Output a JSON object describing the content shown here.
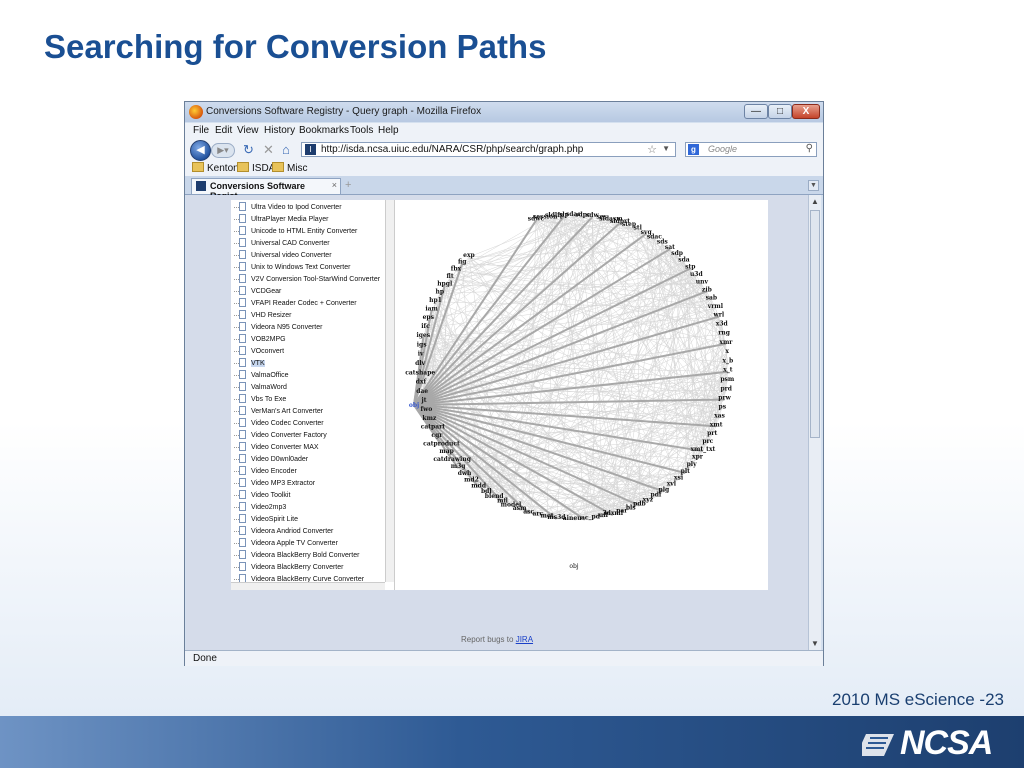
{
  "slide": {
    "title": "Searching for Conversion Paths",
    "footer": "2010 MS eScience -23",
    "logo": "NCSA",
    "colors": {
      "title": "#1a4f93",
      "footer_bar": "#2e5a94"
    }
  },
  "browser": {
    "window_title": "Conversions Software Registry - Query graph - Mozilla Firefox",
    "window_buttons": {
      "minimize": "—",
      "maximize": "□",
      "close": "X"
    },
    "menu": [
      "File",
      "Edit",
      "View",
      "History",
      "Bookmarks",
      "Tools",
      "Help"
    ],
    "url": "http://isda.ncsa.uiuc.edu/NARA/CSR/php/search/graph.php",
    "search_placeholder": "Google",
    "bookmarks": [
      "Kenton",
      "ISDA",
      "Misc"
    ],
    "tab_label": "Conversions Software Regist...",
    "status": "Done",
    "report_text": "Report bugs to",
    "report_link": "JIRA"
  },
  "software_list": [
    "Ultra Video to Ipod Converter",
    "UltraPlayer Media Player",
    "Unicode to HTML Entity Converter",
    "Universal CAD Converter",
    "Universal video Converter",
    "Unix to Windows Text Converter",
    "V2V Conversion Tool-StarWind Converter",
    "VCDGear",
    "VFAPI Reader Codec + Converter",
    "VHD Resizer",
    "Videora N95 Converter",
    "VOB2MPG",
    "VOconvert",
    "VTK",
    "ValmaOffice",
    "ValmaWord",
    "Vbs To Exe",
    "VerMan's Art Converter",
    "Video Codec Converter",
    "Video Converter Factory",
    "Video Converter MAX",
    "Video D0wnl0ader",
    "Video Encoder",
    "Video MP3 Extractor",
    "Video Toolkit",
    "Video2mp3",
    "VideoSpirit Lite",
    "Videora Andriod Converter",
    "Videora Apple TV Converter",
    "Videora BlackBerry Bold Converter",
    "Videora BlackBerry Converter",
    "Videora BlackBerry Curve Converter"
  ],
  "selected_item": "VTK",
  "graph": {
    "source_label": "obj",
    "bottom_label": "obj",
    "nodes": [
      "sdwc",
      "session",
      "sldlfp",
      "slp",
      "sdac",
      "sdpc",
      "sdw",
      "ses",
      "sldasm",
      "sldprt",
      "step",
      "stl",
      "svg",
      "sdac",
      "sds",
      "sat",
      "sdp",
      "sda",
      "stp",
      "u3d",
      "unv",
      "zib",
      "sab",
      "vrml",
      "wrl",
      "x3d",
      "rng",
      "xmr",
      "x",
      "x_b",
      "x_t",
      "psm",
      "prd",
      "prw",
      "ps",
      "xas",
      "xmt",
      "prt",
      "prc",
      "xmt_txt",
      "xpr",
      "ply",
      "plt",
      "xsi",
      "xvl",
      "plg",
      "pdf",
      "xyz",
      "pdb",
      "bls",
      "par",
      "3dxml",
      "uff",
      "_pd",
      "ac",
      "neu",
      "ai",
      "ms3d",
      "mot",
      "arc",
      "asc",
      "asm",
      "model",
      "mfl",
      "blend",
      "bdl",
      "mdd",
      "md2",
      "dwh",
      "m3g",
      "catdrawing",
      "map",
      "catproduct",
      "cgr",
      "catpart",
      "kmz",
      "fwo",
      "jt",
      "dae",
      "dxf",
      "catshape",
      "dlv",
      "iv",
      "igs",
      "iges",
      "ifc",
      "eps",
      "iam",
      "hp1",
      "hp",
      "hpgl",
      "flt",
      "fbx",
      "fig",
      "exp"
    ]
  }
}
